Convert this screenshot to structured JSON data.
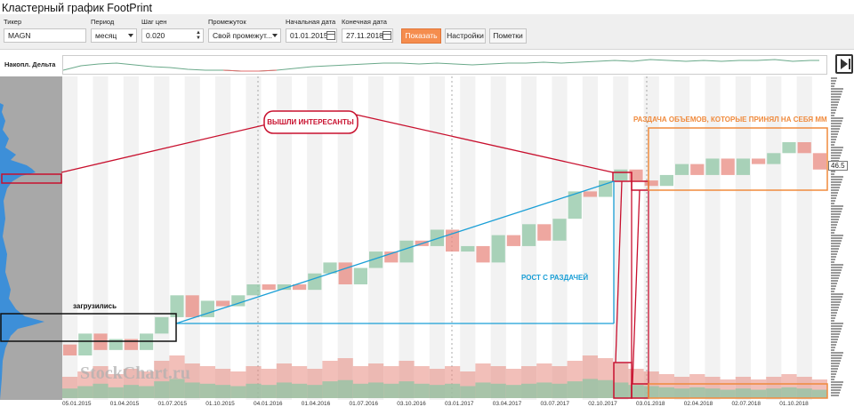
{
  "window": {
    "title": "Кластерный график FootPrint"
  },
  "toolbar": {
    "ticker": {
      "label": "Тикер",
      "value": "MAGN"
    },
    "period": {
      "label": "Период",
      "value": "месяц"
    },
    "price_step": {
      "label": "Шаг цен",
      "value": "0.020"
    },
    "interval": {
      "label": "Промежуток",
      "value": "Свой промежут..."
    },
    "start_date": {
      "label": "Начальная дата",
      "value": "01.01.2015"
    },
    "end_date": {
      "label": "Конечная дата",
      "value": "27.11.2018"
    },
    "show_button": "Показать",
    "settings_button": "Настройки",
    "notes_button": "Пометки"
  },
  "delta": {
    "label": "Накопл. Дельта"
  },
  "price_scale": {
    "current_price": "46.5"
  },
  "annotations": {
    "exit": "ВЫШЛИ ИНТЕРЕСАНТЫ",
    "distribution": "РАЗДАЧА ОБЪЕМОВ, КОТОРЫЕ ПРИНЯЛ НА СЕБЯ ММ",
    "growth": "РОСТ С РАЗДАЧЕЙ",
    "loaded": "загрузились"
  },
  "watermark": "StockChart.ru",
  "colors": {
    "accent": "#f58d4e",
    "up": "#8fc6a4",
    "down": "#e88a80",
    "annot_red": "#c8102e",
    "annot_blue": "#1a9fd6",
    "annot_orange": "#f08a3c"
  },
  "chart_data": {
    "type": "candlestick",
    "x_tick_labels": [
      "05.01.2015",
      "01.04.2015",
      "01.07.2015",
      "01.10.2015",
      "04.01.2016",
      "01.04.2016",
      "01.07.2016",
      "03.10.2016",
      "03.01.2017",
      "03.04.2017",
      "03.07.2017",
      "02.10.2017",
      "03.01.2018",
      "02.04.2018",
      "02.07.2018",
      "01.10.2018"
    ],
    "candles": [
      {
        "o": 16,
        "c": 14
      },
      {
        "o": 14,
        "c": 18
      },
      {
        "o": 18,
        "c": 15
      },
      {
        "o": 15,
        "c": 17
      },
      {
        "o": 17,
        "c": 15
      },
      {
        "o": 15,
        "c": 18
      },
      {
        "o": 18,
        "c": 21
      },
      {
        "o": 21,
        "c": 25
      },
      {
        "o": 25,
        "c": 21
      },
      {
        "o": 21,
        "c": 24
      },
      {
        "o": 24,
        "c": 23
      },
      {
        "o": 23,
        "c": 25
      },
      {
        "o": 25,
        "c": 27
      },
      {
        "o": 27,
        "c": 26
      },
      {
        "o": 26,
        "c": 27
      },
      {
        "o": 27,
        "c": 26
      },
      {
        "o": 26,
        "c": 29
      },
      {
        "o": 29,
        "c": 31
      },
      {
        "o": 31,
        "c": 27
      },
      {
        "o": 27,
        "c": 30
      },
      {
        "o": 30,
        "c": 33
      },
      {
        "o": 33,
        "c": 31
      },
      {
        "o": 31,
        "c": 35
      },
      {
        "o": 35,
        "c": 34
      },
      {
        "o": 34,
        "c": 37
      },
      {
        "o": 37,
        "c": 33
      },
      {
        "o": 33,
        "c": 34
      },
      {
        "o": 34,
        "c": 31
      },
      {
        "o": 31,
        "c": 36
      },
      {
        "o": 36,
        "c": 34
      },
      {
        "o": 34,
        "c": 38
      },
      {
        "o": 38,
        "c": 35
      },
      {
        "o": 35,
        "c": 39
      },
      {
        "o": 39,
        "c": 44
      },
      {
        "o": 44,
        "c": 43
      },
      {
        "o": 43,
        "c": 46
      },
      {
        "o": 46,
        "c": 48
      },
      {
        "o": 48,
        "c": 46
      },
      {
        "o": 46,
        "c": 45
      },
      {
        "o": 45,
        "c": 47
      },
      {
        "o": 47,
        "c": 49
      },
      {
        "o": 49,
        "c": 47
      },
      {
        "o": 47,
        "c": 50
      },
      {
        "o": 50,
        "c": 47
      },
      {
        "o": 47,
        "c": 50
      },
      {
        "o": 50,
        "c": 49
      },
      {
        "o": 49,
        "c": 51
      },
      {
        "o": 51,
        "c": 53
      },
      {
        "o": 53,
        "c": 51
      },
      {
        "o": 51,
        "c": 48
      }
    ],
    "volumes": [
      8,
      10,
      12,
      9,
      11,
      10,
      14,
      16,
      13,
      12,
      11,
      10,
      12,
      11,
      13,
      12,
      11,
      14,
      15,
      12,
      13,
      12,
      14,
      12,
      11,
      12,
      10,
      13,
      12,
      11,
      12,
      13,
      12,
      14,
      16,
      15,
      13,
      11,
      10,
      9,
      8,
      9,
      8,
      7,
      8,
      7,
      8,
      9,
      8,
      7
    ]
  }
}
